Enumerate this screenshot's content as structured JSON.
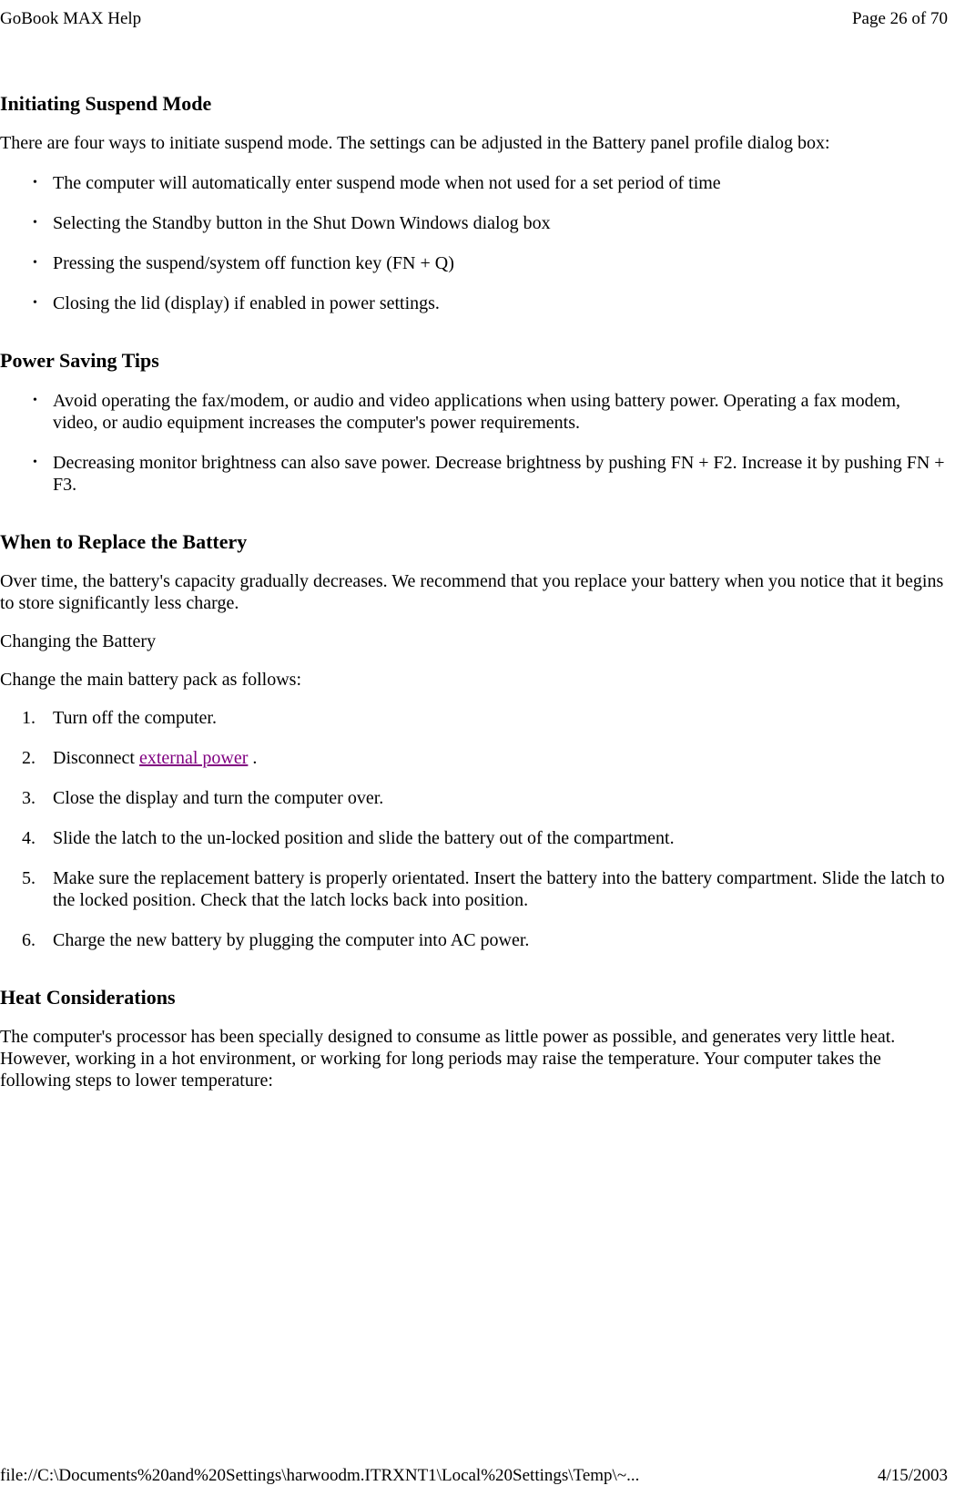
{
  "header": {
    "title": "GoBook MAX Help",
    "page_info": "Page 26 of 70"
  },
  "sections": {
    "suspend": {
      "heading": "Initiating Suspend Mode",
      "intro": "There are four ways to initiate suspend mode. The settings can be adjusted in the Battery panel profile dialog box:",
      "items": [
        "The computer will automatically enter suspend mode when not used for a set period of time",
        "Selecting the Standby button in the Shut Down Windows dialog box",
        "Pressing the suspend/system off function key (FN + Q)",
        "Closing the lid (display) if enabled in power settings."
      ]
    },
    "power_tips": {
      "heading": "Power Saving Tips",
      "items": [
        "Avoid operating the fax/modem, or audio and video applications when using battery power. Operating a fax modem, video, or audio equipment increases the computer's power requirements.",
        "Decreasing monitor brightness can also save power. Decrease brightness by pushing FN + F2. Increase it by pushing FN + F3."
      ]
    },
    "replace_battery": {
      "heading": "When to Replace the Battery",
      "intro": "Over time, the battery's capacity gradually decreases. We recommend that you replace your battery when you notice that it begins to store significantly less charge.",
      "subheading": "Changing the Battery",
      "instruction": "Change the main battery pack as follows:",
      "steps": {
        "step1": "Turn off the computer.",
        "step2_prefix": "Disconnect ",
        "step2_link": "external power",
        "step2_suffix": " .",
        "step3": "Close the display and turn the computer over.",
        "step4": "Slide the latch to the un-locked position and slide the battery out of the compartment.",
        "step5": "Make sure the replacement battery is properly orientated. Insert the battery into the battery compartment.  Slide the latch to the locked position. Check that the latch locks back into position.",
        "step6": "Charge the new battery by plugging the computer into AC power."
      }
    },
    "heat": {
      "heading": "Heat Considerations",
      "intro": "The computer's processor has been specially designed to consume as little power as possible, and generates very little heat. However, working in a hot environment, or working for long periods may raise the temperature. Your computer takes the following steps to lower temperature:"
    }
  },
  "footer": {
    "path": "file://C:\\Documents%20and%20Settings\\harwoodm.ITRXNT1\\Local%20Settings\\Temp\\~...",
    "date": "4/15/2003"
  }
}
